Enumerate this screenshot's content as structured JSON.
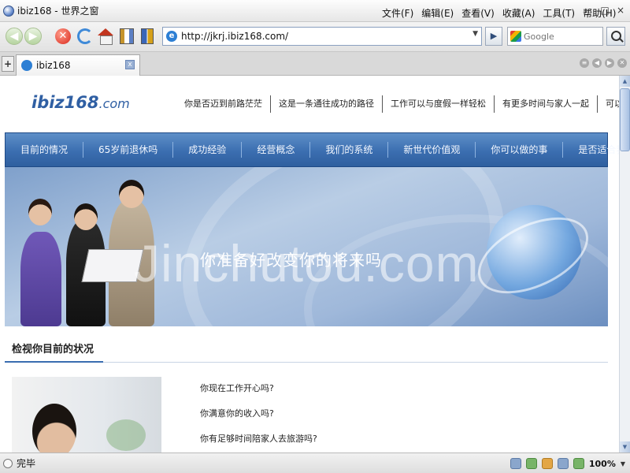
{
  "window": {
    "title": "ibiz168 - 世界之窗",
    "menu": [
      "文件(F)",
      "编辑(E)",
      "查看(V)",
      "收藏(A)",
      "工具(T)",
      "帮助(H)"
    ],
    "controls": [
      "–",
      "□",
      "×"
    ]
  },
  "toolbar": {
    "url": "http://jkrj.ibiz168.com/",
    "search_placeholder": "Google",
    "go_label": "▶"
  },
  "tabs": [
    {
      "label": "ibiz168"
    }
  ],
  "page": {
    "logo_main": "ibiz168",
    "logo_suffix": ".com",
    "top_links": [
      "你是否迈到前路茫茫",
      "这是一条通往成功的路径",
      "工作可以与度假一样轻松",
      "有更多时间与家人一起",
      "可以实现梦想"
    ],
    "nav": [
      "目前的情况",
      "65岁前退休吗",
      "成功经验",
      "经营概念",
      "我们的系统",
      "新世代价值观",
      "你可以做的事",
      "是否适合我们"
    ],
    "banner_text": "你准备好改变你的将来吗",
    "section_title": "检视你目前的状况",
    "questions": [
      "你现在工作开心吗?",
      "你满意你的收入吗?",
      "你有足够时间陪家人去旅游吗?"
    ]
  },
  "watermark": "Jinchutou.com",
  "status": {
    "text": "完毕",
    "zoom": "100%"
  }
}
